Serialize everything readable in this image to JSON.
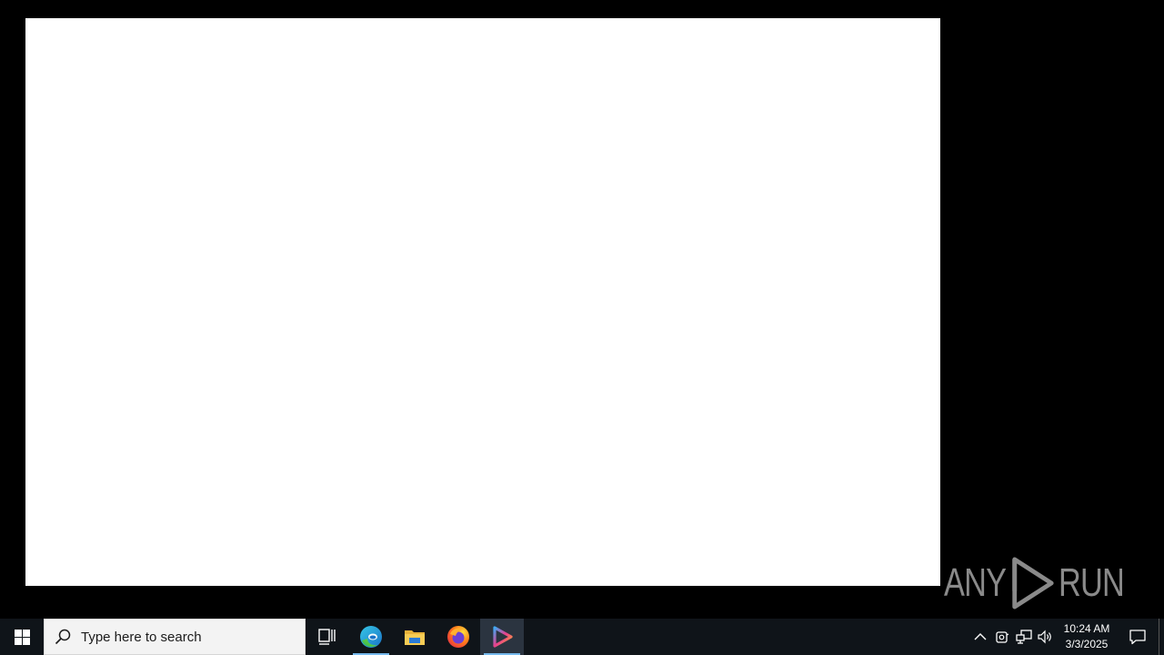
{
  "taskbar": {
    "search": {
      "placeholder": "Type here to search"
    },
    "apps": [
      {
        "name": "Task View",
        "icon": "task-view-icon"
      },
      {
        "name": "Microsoft Edge",
        "icon": "edge-icon"
      },
      {
        "name": "File Explorer",
        "icon": "folder-icon"
      },
      {
        "name": "Firefox",
        "icon": "firefox-icon"
      },
      {
        "name": "Media Player",
        "icon": "play-icon"
      }
    ],
    "clock": {
      "time": "10:24 AM",
      "date": "3/3/2025"
    }
  },
  "watermark": {
    "left": "ANY",
    "right": "RUN"
  },
  "colors": {
    "taskbar_bg": "#0f1419",
    "accent": "#76b9ed",
    "window_bg": "#ffffff",
    "watermark": "#8a8a8a"
  }
}
